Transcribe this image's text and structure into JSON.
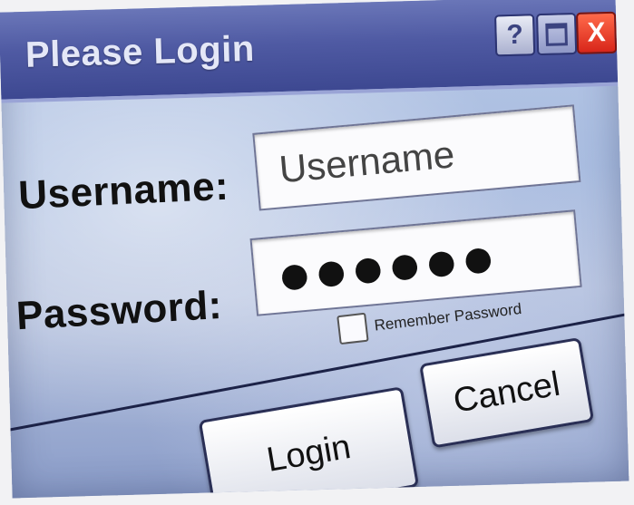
{
  "window": {
    "title": "Please Login",
    "controls": {
      "help_glyph": "?",
      "close_glyph": "X"
    }
  },
  "form": {
    "username_label": "Username:",
    "username_value": "Username",
    "password_label": "Password:",
    "password_mask": "●●●●●●",
    "remember_label": "Remember Password",
    "remember_checked": false
  },
  "buttons": {
    "login_label": "Login",
    "cancel_label": "Cancel"
  },
  "icons": {
    "help": "help-icon",
    "maximize": "maximize-icon",
    "close": "close-icon"
  },
  "colors": {
    "titlebar": "#4f5aa3",
    "title_text": "#e4e7f7",
    "close_button": "#d8261a",
    "background": "#a8bce0"
  }
}
